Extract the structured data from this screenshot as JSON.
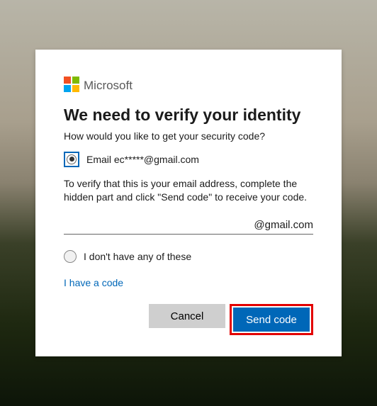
{
  "brand": {
    "name": "Microsoft"
  },
  "title": "We need to verify your identity",
  "subtitle": "How would you like to get your security code?",
  "option_email": {
    "label": "Email ec*****@gmail.com"
  },
  "instructions": "To verify that this is your email address, complete the hidden part and click \"Send code\" to receive your code.",
  "email_input": {
    "value": "",
    "suffix": "@gmail.com"
  },
  "option_none": {
    "label": "I don't have any of these"
  },
  "have_code_link": "I have a code",
  "buttons": {
    "cancel": "Cancel",
    "send": "Send code"
  }
}
